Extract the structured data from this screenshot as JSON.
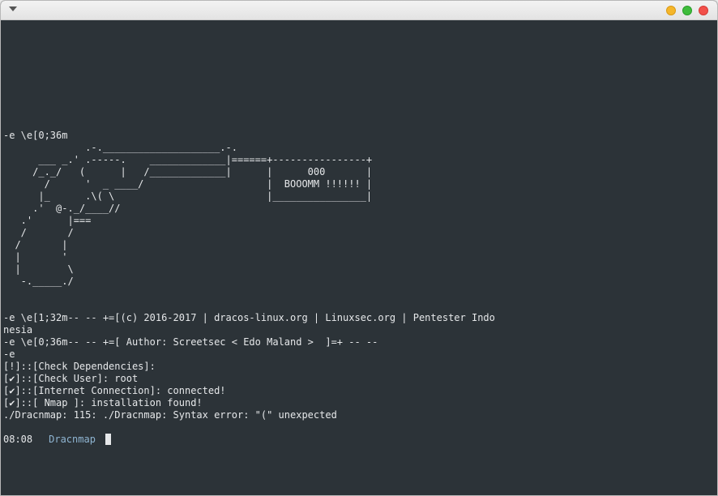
{
  "window": {
    "controls": [
      "minimize",
      "maximize",
      "close"
    ],
    "colors": {
      "minimize": "#f5b62a",
      "maximize": "#3fbc3c",
      "close": "#f2504a",
      "background": "#2c3338"
    }
  },
  "terminal": {
    "output": "-e \\e[0;36m\n              .-.____________________.-.\n      ___ _.' .-----.    _____________|======+----------------+\n     /_._/   (      |   /_____________|      |      000       |\n       /      '  _ ____/                     |  BOOOMM !!!!!! |\n      |_      .\\( \\                          |________________|\n     .'  @-._/____//\n   .'      |===\n   /       /\n  /       |\n  |       '\n  |        \\\n   -._____./\n\n\n-e \\e[1;32m-- -- +=[(c) 2016-2017 | dracos-linux.org | Linuxsec.org | Pentester Indo\nnesia\n-e \\e[0;36m-- -- +=[ Author: Screetsec < Edo Maland >  ]=+ -- --\n-e\n[!]::[Check Dependencies]:\n[✔]::[Check User]: root\n[✔]::[Internet Connection]: connected!\n[✔]::[ Nmap ]: installation found!\n./Dracnmap: 115: ./Dracnmap: Syntax error: \"(\" unexpected",
    "prompt": {
      "time": "08:08",
      "directory": "Dracnmap"
    }
  }
}
